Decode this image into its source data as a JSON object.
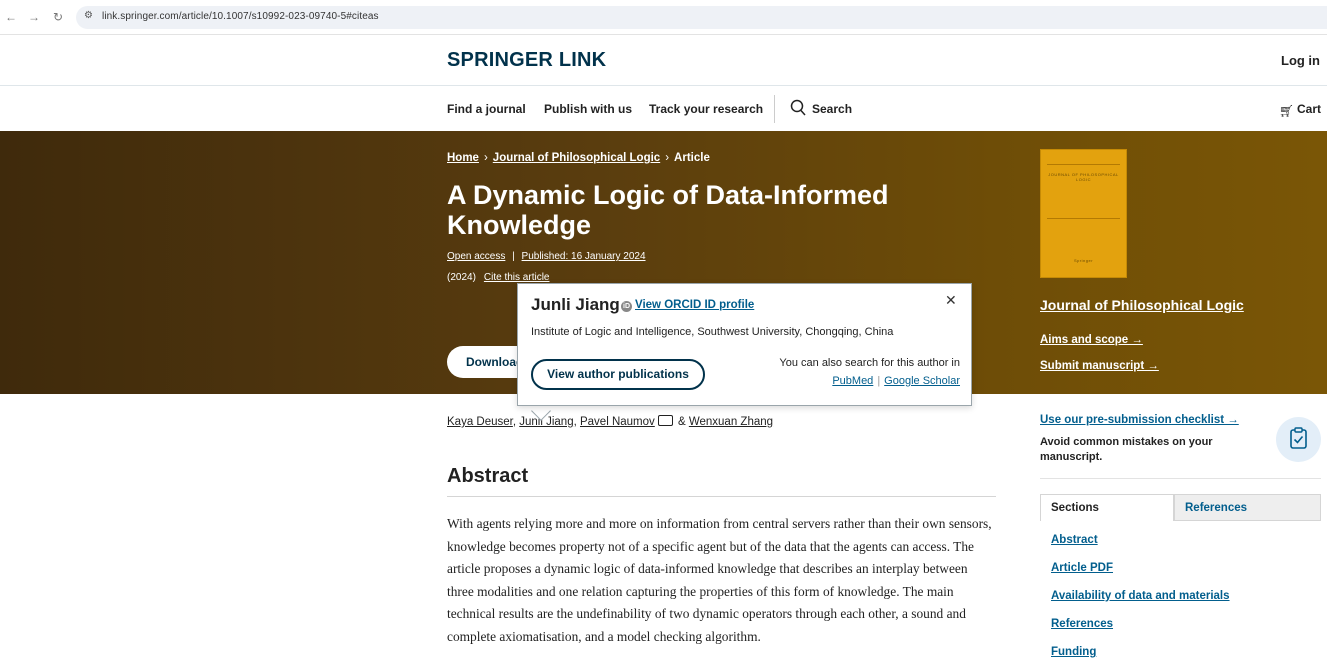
{
  "browser": {
    "url": "link.springer.com/article/10.1007/s10992-023-09740-5#citeas"
  },
  "header": {
    "logo": "SPRINGER LINK",
    "login": "Log in",
    "nav": {
      "find_journal": "Find a journal",
      "publish": "Publish with us",
      "track": "Track your research",
      "search": "Search",
      "cart": "Cart"
    }
  },
  "breadcrumb": {
    "home": "Home",
    "journal": "Journal of Philosophical Logic",
    "current": "Article",
    "separator": "›"
  },
  "article": {
    "title": "A Dynamic Logic of Data-Informed Knowledge",
    "open_access": "Open access",
    "published": "Published: 16 January 2024",
    "year": "(2024)",
    "cite": "Cite this article",
    "download_label": "Download PDF"
  },
  "journal_panel": {
    "name": "Journal of Philosophical Logic",
    "aims": "Aims and scope →",
    "submit": "Submit manuscript →",
    "cover_title": "JOURNAL OF PHILOSOPHICAL LOGIC",
    "cover_publisher": "Springer"
  },
  "author_popup": {
    "name": "Junli Jiang",
    "orcid_link": "View ORCID ID profile",
    "affiliation": "Institute of Logic and Intelligence, Southwest University, Chongqing, China",
    "view_publications": "View author publications",
    "search_note": "You can also search for this author in",
    "pubmed": "PubMed",
    "scholar": "Google Scholar",
    "separator": "|"
  },
  "authors": {
    "a1": "Kaya Deuser",
    "sep1": ", ",
    "a2": "Junli Jiang",
    "sep2": ", ",
    "a3": "Pavel Naumov",
    "amp": " & ",
    "a4": "Wenxuan Zhang"
  },
  "abstract": {
    "heading": "Abstract",
    "text": "With agents relying more and more on information from central servers rather than their own sensors, knowledge becomes property not of a specific agent but of the data that the agents can access. The article proposes a dynamic logic of data-informed knowledge that describes an interplay between three modalities and one relation capturing the properties of this form of knowledge. The main technical results are the undefinability of two dynamic operators through each other, a sound and complete axiomatisation, and a model checking algorithm."
  },
  "sidebar": {
    "checklist_link": "Use our pre-submission checklist →",
    "checklist_text": "Avoid common mistakes on your manuscript.",
    "tabs": {
      "sections": "Sections",
      "references": "References"
    },
    "links": [
      "Abstract",
      "Article PDF",
      "Availability of data and materials",
      "References",
      "Funding"
    ]
  },
  "colors": {
    "brand": "#01324b",
    "link": "#025e8d",
    "hero_start": "#3f2a0c",
    "hero_end": "#7a5606",
    "cover": "#e3a20e"
  }
}
